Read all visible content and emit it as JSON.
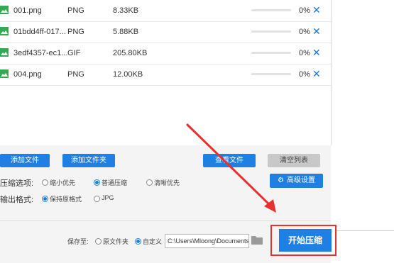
{
  "files": [
    {
      "name": "001.png",
      "type": "PNG",
      "size": "8.33KB",
      "progress_percent": 0,
      "percent": "0%"
    },
    {
      "name": "01bdd4ff-017...",
      "type": "PNG",
      "size": "5.88KB",
      "progress_percent": 0,
      "percent": "0%"
    },
    {
      "name": "3edf4357-ec1...",
      "type": "GIF",
      "size": "205.80KB",
      "progress_percent": 0,
      "percent": "0%"
    },
    {
      "name": "004.png",
      "type": "PNG",
      "size": "12.00KB",
      "progress_percent": 0,
      "percent": "0%"
    }
  ],
  "close_symbol": "✕",
  "toolbar": {
    "add_file": "添加文件",
    "add_folder": "添加文件夹",
    "view_file": "查看文件",
    "clear_list": "清空列表"
  },
  "compress": {
    "label": "压缩选项:",
    "options": [
      "缩小优先",
      "普通压缩",
      "清晰优先"
    ],
    "selected": "普通压缩"
  },
  "advanced_settings": {
    "label": "高级设置",
    "icon": "gear-icon"
  },
  "output": {
    "label": "输出格式:",
    "options": [
      "保持原格式",
      "JPG"
    ],
    "selected": "保持原格式"
  },
  "save": {
    "label": "保存至:",
    "options": [
      "原文件夹",
      "自定义"
    ],
    "selected": "自定义",
    "path": "C:\\Users\\Mloong\\Documents"
  },
  "start_button": "开始压缩",
  "colors": {
    "accent": "#1f7fe2",
    "annotation": "#e8312f",
    "icon_green": "#34a853"
  }
}
